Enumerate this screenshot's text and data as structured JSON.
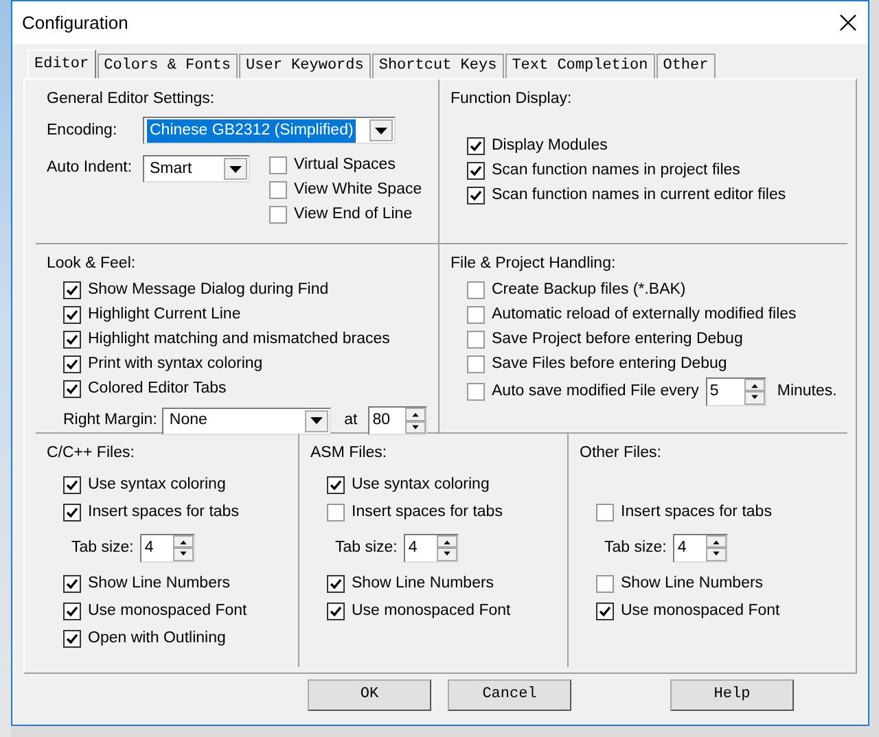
{
  "window": {
    "title": "Configuration"
  },
  "tabs": [
    {
      "label": "Editor",
      "selected": true
    },
    {
      "label": "Colors & Fonts",
      "selected": false
    },
    {
      "label": "User Keywords",
      "selected": false
    },
    {
      "label": "Shortcut Keys",
      "selected": false
    },
    {
      "label": "Text Completion",
      "selected": false
    },
    {
      "label": "Other",
      "selected": false
    }
  ],
  "general": {
    "heading": "General Editor Settings:",
    "encoding": {
      "label": "Encoding:",
      "value": "Chinese GB2312 (Simplified)",
      "focused": true
    },
    "auto_indent": {
      "label": "Auto Indent:",
      "value": "Smart"
    },
    "checkboxes": [
      {
        "label": "Virtual Spaces",
        "checked": false
      },
      {
        "label": "View White Space",
        "checked": false
      },
      {
        "label": "View End of Line",
        "checked": false
      }
    ]
  },
  "function_display": {
    "heading": "Function Display:",
    "checkboxes": [
      {
        "label": "Display Modules",
        "checked": true
      },
      {
        "label": "Scan function names in project files",
        "checked": true
      },
      {
        "label": "Scan function names in current editor files",
        "checked": true
      }
    ]
  },
  "look_feel": {
    "heading": "Look & Feel:",
    "checkboxes": [
      {
        "label": "Show Message Dialog during Find",
        "checked": true
      },
      {
        "label": "Highlight Current Line",
        "checked": true
      },
      {
        "label": "Highlight matching and mismatched braces",
        "checked": true
      },
      {
        "label": "Print with syntax coloring",
        "checked": true
      },
      {
        "label": "Colored Editor Tabs",
        "checked": true
      }
    ],
    "right_margin": {
      "label": "Right Margin:",
      "value": "None",
      "at_label": "at",
      "at_value": "80"
    }
  },
  "file_handling": {
    "heading": "File & Project Handling:",
    "checkboxes": [
      {
        "label": "Create Backup files (*.BAK)",
        "checked": false
      },
      {
        "label": "Automatic reload of externally modified files",
        "checked": false
      },
      {
        "label": "Save Project before entering Debug",
        "checked": false
      },
      {
        "label": "Save Files before entering Debug",
        "checked": false
      }
    ],
    "autosave": {
      "label": "Auto save modified File every",
      "checked": false,
      "value": "5",
      "suffix": "Minutes."
    }
  },
  "file_types": [
    {
      "heading": "C/C++ Files:",
      "syntax_coloring": {
        "label": "Use syntax coloring",
        "checked": true
      },
      "insert_spaces": {
        "label": "Insert spaces for tabs",
        "checked": true
      },
      "tab_size": {
        "label": "Tab size:",
        "value": "4"
      },
      "line_numbers": {
        "label": "Show Line Numbers",
        "checked": true
      },
      "monospaced": {
        "label": "Use monospaced Font",
        "checked": true
      },
      "outlining": {
        "label": "Open with Outlining",
        "checked": true
      }
    },
    {
      "heading": "ASM Files:",
      "syntax_coloring": {
        "label": "Use syntax coloring",
        "checked": true
      },
      "insert_spaces": {
        "label": "Insert spaces for tabs",
        "checked": false
      },
      "tab_size": {
        "label": "Tab size:",
        "value": "4"
      },
      "line_numbers": {
        "label": "Show Line Numbers",
        "checked": true
      },
      "monospaced": {
        "label": "Use monospaced Font",
        "checked": true
      }
    },
    {
      "heading": "Other Files:",
      "insert_spaces": {
        "label": "Insert spaces for tabs",
        "checked": false
      },
      "tab_size": {
        "label": "Tab size:",
        "value": "4"
      },
      "line_numbers": {
        "label": "Show Line Numbers",
        "checked": false
      },
      "monospaced": {
        "label": "Use monospaced Font",
        "checked": true
      }
    }
  ],
  "buttons": [
    "OK",
    "Cancel",
    "Help"
  ]
}
